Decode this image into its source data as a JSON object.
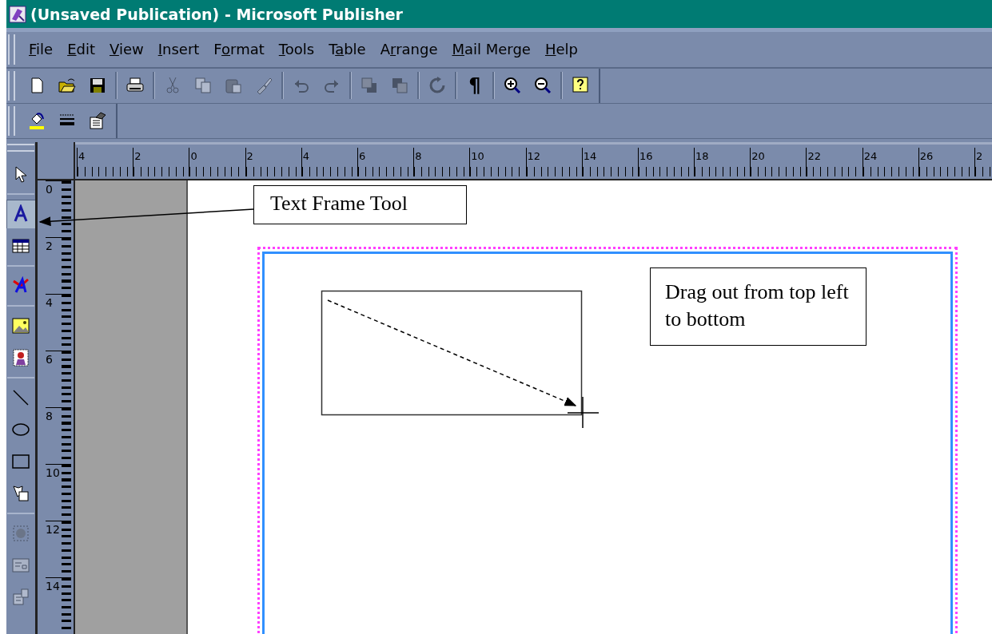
{
  "window": {
    "title": "(Unsaved Publication) - Microsoft Publisher"
  },
  "menu": [
    {
      "key": "F",
      "after": "ile"
    },
    {
      "key": "E",
      "after": "dit"
    },
    {
      "key": "V",
      "after": "iew"
    },
    {
      "key": "I",
      "after": "nsert"
    },
    {
      "before": "F",
      "key": "o",
      "after": "rmat"
    },
    {
      "key": "T",
      "after": "ools"
    },
    {
      "before": "T",
      "key": "a",
      "after": "ble"
    },
    {
      "before": "A",
      "key": "r",
      "after": "range"
    },
    {
      "key": "M",
      "after": "ail Merge"
    },
    {
      "key": "H",
      "after": "elp"
    }
  ],
  "toolbar_standard": [
    [
      {
        "kind": "new",
        "disabled": false
      },
      {
        "kind": "open",
        "disabled": false
      },
      {
        "kind": "save",
        "disabled": false
      }
    ],
    [
      {
        "kind": "print",
        "disabled": false
      }
    ],
    [
      {
        "kind": "cut",
        "disabled": true
      },
      {
        "kind": "copy",
        "disabled": true
      },
      {
        "kind": "paste",
        "disabled": true
      },
      {
        "kind": "brush",
        "disabled": true
      }
    ],
    [
      {
        "kind": "undo",
        "disabled": true
      },
      {
        "kind": "redo",
        "disabled": true
      }
    ],
    [
      {
        "kind": "front",
        "disabled": true
      },
      {
        "kind": "back",
        "disabled": true
      }
    ],
    [
      {
        "kind": "rotate",
        "disabled": true
      }
    ],
    [
      {
        "kind": "glyph",
        "glyph": "¶",
        "disabled": false
      }
    ],
    [
      {
        "kind": "zoomin",
        "disabled": false
      },
      {
        "kind": "zoomout",
        "disabled": false
      }
    ],
    [
      {
        "kind": "help",
        "disabled": false
      }
    ]
  ],
  "toolbar_formatting": [
    [
      {
        "kind": "fill",
        "disabled": false
      },
      {
        "kind": "linestyle",
        "disabled": false
      },
      {
        "kind": "properties",
        "disabled": false
      }
    ]
  ],
  "tools": [
    [
      {
        "kind": "pointer",
        "selected": false,
        "disabled": false
      }
    ],
    [
      {
        "kind": "text",
        "selected": true,
        "disabled": false
      },
      {
        "kind": "table",
        "selected": false,
        "disabled": false
      }
    ],
    [
      {
        "kind": "wordart",
        "selected": false,
        "disabled": false
      }
    ],
    [
      {
        "kind": "picture",
        "selected": false,
        "disabled": false
      },
      {
        "kind": "clipart",
        "selected": false,
        "disabled": false
      }
    ],
    [
      {
        "kind": "line",
        "selected": false,
        "disabled": false
      },
      {
        "kind": "oval",
        "selected": false,
        "disabled": false
      },
      {
        "kind": "rect",
        "selected": false,
        "disabled": false
      },
      {
        "kind": "shapes",
        "selected": false,
        "disabled": false
      }
    ],
    [
      {
        "kind": "hotspot",
        "selected": false,
        "disabled": true
      },
      {
        "kind": "form",
        "selected": false,
        "disabled": true
      },
      {
        "kind": "html",
        "selected": false,
        "disabled": true
      }
    ]
  ],
  "ruler_horizontal": [
    "4",
    "2",
    "0",
    "2",
    "4",
    "6",
    "8",
    "10",
    "12",
    "14",
    "16",
    "18",
    "20",
    "22",
    "24",
    "26",
    "2"
  ],
  "ruler_vertical": [
    "0",
    "2",
    "4",
    "6",
    "8",
    "10",
    "12",
    "14"
  ],
  "callouts": [
    {
      "text": "Text Frame Tool"
    },
    {
      "text": "Drag out from top left to bottom"
    }
  ]
}
